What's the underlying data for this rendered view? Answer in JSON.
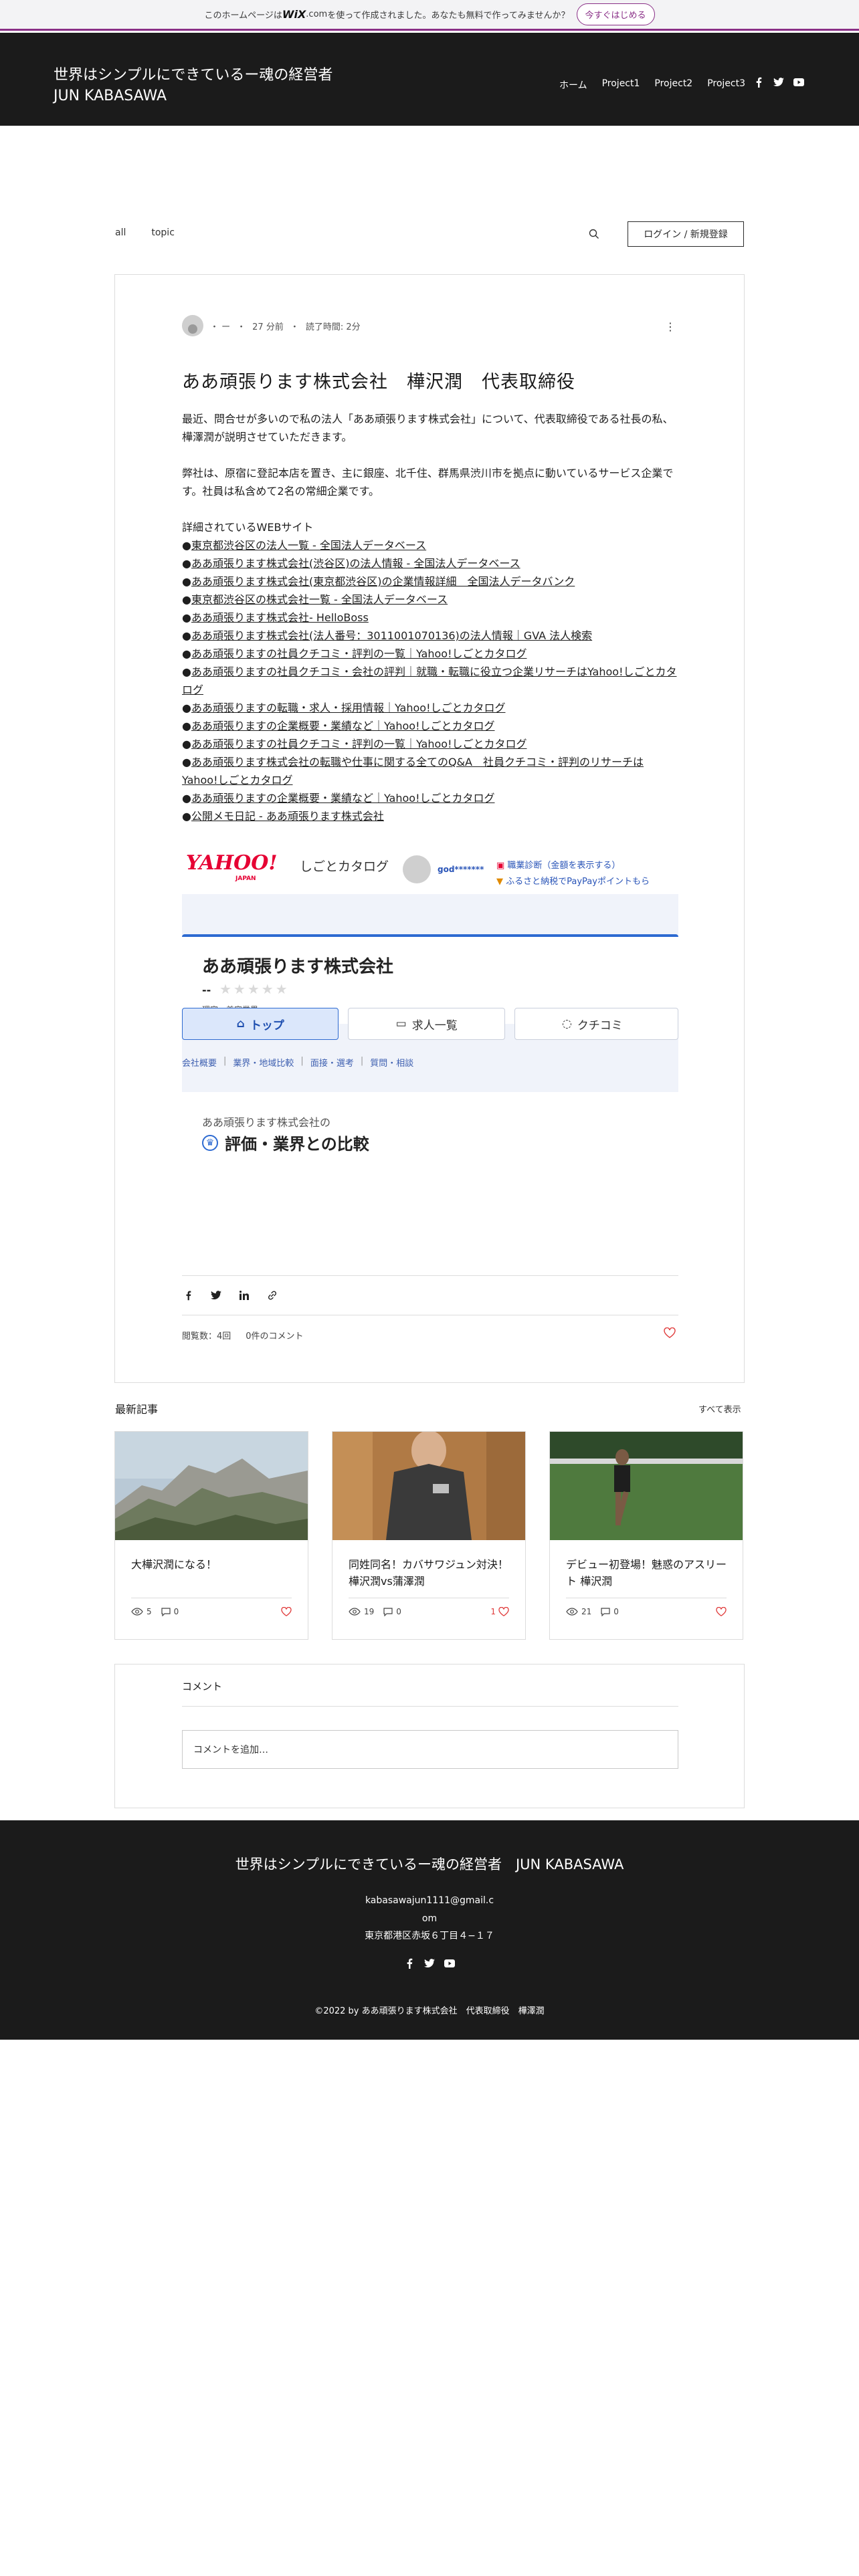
{
  "wix_banner": {
    "text_before": "このホームページは",
    "brand": "WiX",
    "brand_suffix": ".com",
    "text_after": " を使って作成されました。あなたも無料で作ってみませんか？",
    "cta": "今すぐはじめる",
    "accent": "#8a2f87"
  },
  "header": {
    "title_line1": "世界はシンプルにできているー魂の経営者",
    "title_line2": "JUN KABASAWA",
    "nav": [
      "ホーム",
      "Project1",
      "Project2",
      "Project3"
    ],
    "social": [
      "facebook-icon",
      "twitter-icon",
      "youtube-icon"
    ]
  },
  "blog_bar": {
    "tabs": [
      "all",
      "topic"
    ],
    "login": "ログイン / 新規登録"
  },
  "post": {
    "author": "・ ー",
    "time": "27 分前",
    "read_time": "読了時間: 2分",
    "title": "ああ頑張ります株式会社　樺沢潤　代表取締役",
    "para1": "最近、問合せが多いので私の法人「ああ頑張ります株式会社」について、代表取締役である社長の私、樺澤潤が説明させていただきます。",
    "para2": "弊社は、原宿に登記本店を置き、主に銀座、北千住、群馬県渋川市を拠点に動いているサービス企業です。社員は私含めて2名の常細企業です。",
    "links_heading": "詳細されているWEBサイト",
    "links": [
      "東京都渋谷区の法人一覧 - 全国法人データベース",
      "ああ頑張ります株式会社(渋谷区)の法人情報 - 全国法人データベース",
      "ああ頑張ります株式会社(東京都渋谷区)の企業情報詳細　全国法人データバンク",
      "東京都渋谷区の株式会社一覧 - 全国法人データベース",
      "ああ頑張ります株式会社- HelloBoss",
      "ああ頑張ります株式会社(法人番号：3011001070136)の法人情報｜GVA 法人検索",
      "ああ頑張りますの社員クチコミ・評判の一覧｜Yahoo!しごとカタログ",
      "ああ頑張りますの社員クチコミ・会社の評判｜就職・転職に役立つ企業リサーチはYahoo!しごとカタログ",
      "ああ頑張りますの転職・求人・採用情報｜Yahoo!しごとカタログ",
      "ああ頑張りますの企業概要・業績など｜Yahoo!しごとカタログ",
      "ああ頑張りますの社員クチコミ・評判の一覧｜Yahoo!しごとカタログ",
      "ああ頑張ります株式会社の転職や仕事に関する全てのQ&A　社員クチコミ・評判のリサーチはYahoo!しごとカタログ",
      "ああ頑張りますの企業概要・業績など｜Yahoo!しごとカタログ",
      "公開メモ日記 - ああ頑張ります株式会社"
    ],
    "bullet": "●",
    "views": "閲覧数：4回",
    "comments": "0件のコメント"
  },
  "embed": {
    "logo": "YAHOO!",
    "logo_sub": "JAPAN",
    "service": "しごとカタログ",
    "user": "god*******",
    "link1": "職業診断（金額を表示する）",
    "link2": "ふるさと納税でPayPayポイントもら",
    "company": "ああ頑張ります株式会社",
    "rating_dash": "--",
    "stars": "★★★★★",
    "category": "理容・美容業界",
    "tabs": [
      "トップ",
      "求人一覧",
      "クチコミ"
    ],
    "sublinks": [
      "会社概要",
      "業界・地域比較",
      "面接・選考",
      "質問・相談"
    ],
    "compare_of": "ああ頑張ります株式会社の",
    "compare_title": "評価・業界との比較"
  },
  "recent": {
    "heading": "最新記事",
    "see_all": "すべて表示",
    "items": [
      {
        "title": "大樺沢潤になる！",
        "views": "5",
        "comments": "0",
        "likes": ""
      },
      {
        "title": "同姓同名！カバサワジュン対決！樺沢潤vs蒲澤潤",
        "views": "19",
        "comments": "0",
        "likes": "1"
      },
      {
        "title": "デビュー初登場！魅惑のアスリート 樺沢潤",
        "views": "21",
        "comments": "0",
        "likes": ""
      }
    ]
  },
  "comments": {
    "title": "コメント",
    "placeholder": "コメントを追加…"
  },
  "footer": {
    "title": "世界はシンプルにできているー魂の経営者　JUN KABASAWA",
    "email": "kabasawajun1111@gmail.com",
    "address": "東京都港区赤坂６丁目４−１７",
    "copyright": "©2022 by ああ頑張ります株式会社　代表取締役　樺澤潤"
  }
}
